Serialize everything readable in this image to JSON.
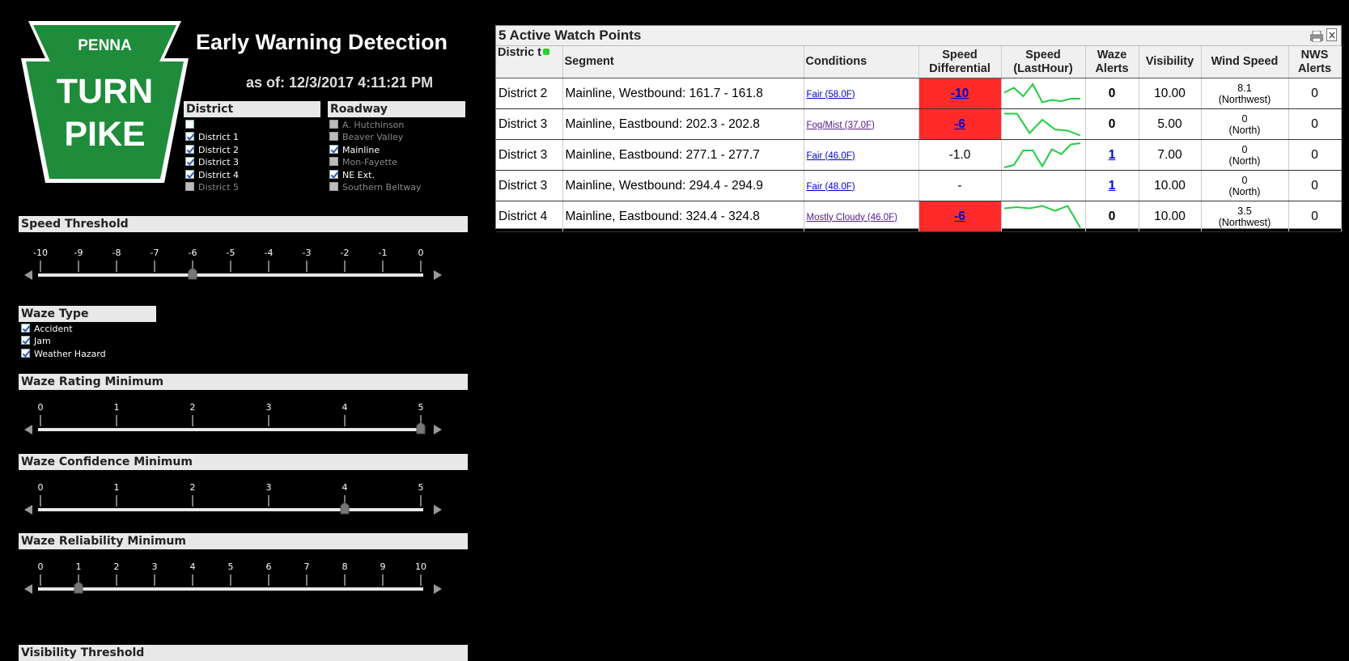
{
  "header": {
    "logo": {
      "top": "PENNA",
      "line1": "TURN",
      "line2": "PIKE",
      "color": "#1e8c3a"
    },
    "title": "Early Warning Detection",
    "as_of": "as of: 12/3/2017 4:11:21 PM"
  },
  "district_filter": {
    "title": "District",
    "items": [
      {
        "label": "",
        "checked": false,
        "enabled": true
      },
      {
        "label": "District 1",
        "checked": true,
        "enabled": true
      },
      {
        "label": "District 2",
        "checked": true,
        "enabled": true
      },
      {
        "label": "District 3",
        "checked": true,
        "enabled": true
      },
      {
        "label": "District 4",
        "checked": true,
        "enabled": true
      },
      {
        "label": "District 5",
        "checked": false,
        "enabled": false
      }
    ]
  },
  "roadway_filter": {
    "title": "Roadway",
    "items": [
      {
        "label": "A. Hutchinson",
        "checked": false,
        "enabled": false
      },
      {
        "label": "Beaver Valley",
        "checked": false,
        "enabled": false
      },
      {
        "label": "Mainline",
        "checked": true,
        "enabled": true
      },
      {
        "label": "Mon-Fayette",
        "checked": false,
        "enabled": false
      },
      {
        "label": "NE Ext.",
        "checked": true,
        "enabled": true
      },
      {
        "label": "Southern Beltway",
        "checked": false,
        "enabled": false
      }
    ]
  },
  "speed_threshold": {
    "title": "Speed Threshold",
    "ticks": [
      "-10",
      "-9",
      "-8",
      "-7",
      "-6",
      "-5",
      "-4",
      "-3",
      "-2",
      "-1",
      "0"
    ],
    "value": -6,
    "min": -10,
    "max": 0
  },
  "waze_type": {
    "title": "Waze Type",
    "items": [
      {
        "label": "Accident",
        "checked": true
      },
      {
        "label": "Jam",
        "checked": true
      },
      {
        "label": "Weather Hazard",
        "checked": true
      }
    ]
  },
  "waze_rating": {
    "title": "Waze Rating Minimum",
    "ticks": [
      "0",
      "1",
      "2",
      "3",
      "4",
      "5"
    ],
    "value": 5,
    "min": 0,
    "max": 5
  },
  "waze_confidence": {
    "title": "Waze Confidence Minimum",
    "ticks": [
      "0",
      "1",
      "2",
      "3",
      "4",
      "5"
    ],
    "value": 4,
    "min": 0,
    "max": 5
  },
  "waze_reliability": {
    "title": "Waze Reliability Minimum",
    "ticks": [
      "0",
      "1",
      "2",
      "3",
      "4",
      "5",
      "6",
      "7",
      "8",
      "9",
      "10"
    ],
    "value": 1,
    "min": 0,
    "max": 10
  },
  "visibility_threshold": {
    "title": "Visibility Threshold"
  },
  "watch_table": {
    "caption": "5 Active Watch Points",
    "icons": [
      "print-icon",
      "export-excel-icon"
    ],
    "headers": {
      "district": "Distric t",
      "segment": "Segment",
      "conditions": "Conditions",
      "speed_diff": "Speed Differential",
      "speed_last_hour": "Speed (LastHour)",
      "waze_alerts": "Waze Alerts",
      "visibility": "Visibility",
      "wind_speed": "Wind Speed",
      "nws_alerts": "NWS Alerts"
    },
    "highlight_color": "#ff2a2a",
    "sparkline_color": "#22cc44",
    "rows": [
      {
        "district": "District 2",
        "segment": "Mainline, Westbound: 161.7 - 161.8",
        "conditions": "Fair (58.0F)",
        "speed_diff": "-10",
        "speed_diff_link": true,
        "highlight": true,
        "spark": [
          0.55,
          0.75,
          0.4,
          0.9,
          0.15,
          0.25,
          0.2,
          0.3,
          0.3
        ],
        "waze_alerts": "0",
        "waze_link": false,
        "visibility": "10.00",
        "wind_value": "8.1",
        "wind_dir": "(Northwest)",
        "nws_alerts": "0"
      },
      {
        "district": "District 3",
        "segment": "Mainline, Eastbound: 202.3 - 202.8",
        "conditions": "Fog/Mist (37.0F)",
        "speed_diff": "-6",
        "speed_diff_link": true,
        "highlight": true,
        "spark": [
          0.95,
          0.95,
          0.15,
          0.7,
          0.3,
          0.25,
          0.05
        ],
        "waze_alerts": "0",
        "waze_link": false,
        "visibility": "5.00",
        "wind_value": "0",
        "wind_dir": "(North)",
        "nws_alerts": "0"
      },
      {
        "district": "District 3",
        "segment": "Mainline, Eastbound: 277.1 - 277.7",
        "conditions": "Fair (46.0F)",
        "speed_diff": "-1.0",
        "speed_diff_link": false,
        "highlight": false,
        "spark": [
          0.0,
          0.1,
          0.7,
          0.7,
          0.05,
          0.75,
          0.55,
          0.95,
          1.0
        ],
        "waze_alerts": "1",
        "waze_link": true,
        "visibility": "7.00",
        "wind_value": "0",
        "wind_dir": "(North)",
        "nws_alerts": "0"
      },
      {
        "district": "District 3",
        "segment": "Mainline, Westbound: 294.4 - 294.9",
        "conditions": "Fair (48.0F)",
        "speed_diff": "-",
        "speed_diff_link": false,
        "highlight": false,
        "spark": [],
        "waze_alerts": "1",
        "waze_link": true,
        "visibility": "10.00",
        "wind_value": "0",
        "wind_dir": "(North)",
        "nws_alerts": "0"
      },
      {
        "district": "District 4",
        "segment": "Mainline, Eastbound: 324.4 - 324.8",
        "conditions": "Mostly Cloudy (46.0F)",
        "speed_diff": "-6",
        "speed_diff_link": true,
        "highlight": true,
        "spark": [
          0.85,
          0.9,
          0.85,
          0.95,
          0.75,
          0.95,
          0.05
        ],
        "waze_alerts": "0",
        "waze_link": false,
        "visibility": "10.00",
        "wind_value": "3.5",
        "wind_dir": "(Northwest)",
        "nws_alerts": "0"
      }
    ]
  }
}
